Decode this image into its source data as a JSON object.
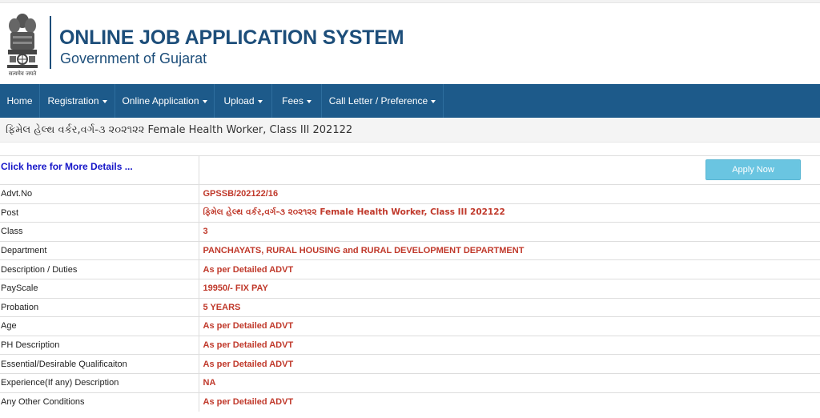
{
  "header": {
    "title": "ONLINE JOB APPLICATION SYSTEM",
    "subtitle": "Government of Gujarat",
    "emblem_caption": "सत्यमेव जयते",
    "title_color": "#1d4e7a"
  },
  "nav": {
    "background": "#1d5a8a",
    "items": [
      {
        "label": "Home"
      },
      {
        "label": "Registration"
      },
      {
        "label": "Online Application"
      },
      {
        "label": "Upload"
      },
      {
        "label": "Fees"
      },
      {
        "label": "Call Letter / Preference"
      }
    ]
  },
  "banner": {
    "post_title": "ફિમેલ હેલ્થ વર્કર,વર્ગ-૩ ૨૦૨૧૨૨ Female Health Worker, Class III 202122"
  },
  "details": {
    "more_details_link": "Click here for More Details ...",
    "apply_button": "Apply Now",
    "rows": [
      {
        "label": "Advt.No",
        "value": "GPSSB/202122/16"
      },
      {
        "label": "Post",
        "value": "ફિમેલ હેલ્થ વર્કર,વર્ગ-૩ ૨૦૨૧૨૨ Female Health Worker, Class III 202122"
      },
      {
        "label": "Class",
        "value": "3"
      },
      {
        "label": "Department",
        "value": "PANCHAYATS, RURAL HOUSING and RURAL DEVELOPMENT DEPARTMENT"
      },
      {
        "label": "Description / Duties",
        "value": "As per Detailed ADVT"
      },
      {
        "label": "PayScale",
        "value": "19950/- FIX PAY"
      },
      {
        "label": "Probation",
        "value": "5 YEARS"
      },
      {
        "label": "Age",
        "value": "As per Detailed ADVT"
      },
      {
        "label": "PH Description",
        "value": "As per Detailed ADVT"
      },
      {
        "label": "Essential/Desirable Qualificaiton",
        "value": "As per Detailed ADVT"
      },
      {
        "label": "Experience(If any) Description",
        "value": "NA"
      },
      {
        "label": "Any Other Conditions",
        "value": "As per Detailed ADVT"
      }
    ]
  },
  "colors": {
    "value_text": "#c0392b",
    "link_text": "#1515c8",
    "apply_button": "#6ac5e1"
  }
}
